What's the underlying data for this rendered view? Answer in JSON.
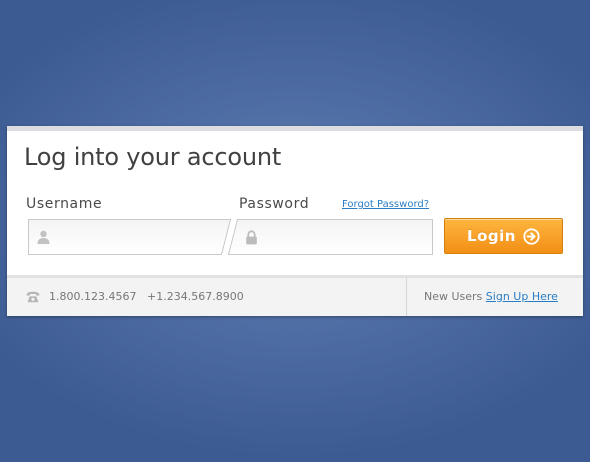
{
  "panel": {
    "title": "Log into your account"
  },
  "form": {
    "username_label": "Username",
    "username_value": "",
    "username_placeholder": "",
    "password_label": "Password",
    "password_value": "",
    "password_placeholder": "",
    "forgot_link": "Forgot Password?",
    "login_label": "Login"
  },
  "footer": {
    "phone_primary": "1.800.123.4567",
    "phone_secondary": "+1.234.567.8900",
    "new_users_text": "New Users",
    "signup_link": "Sign Up Here"
  },
  "icons": {
    "username": "user-icon",
    "password": "lock-icon",
    "login": "arrow-right-circle-icon",
    "phone": "phone-icon"
  },
  "colors": {
    "background": "#4f6ea4",
    "accent": "#f9a22a",
    "link": "#2a7dc4"
  }
}
